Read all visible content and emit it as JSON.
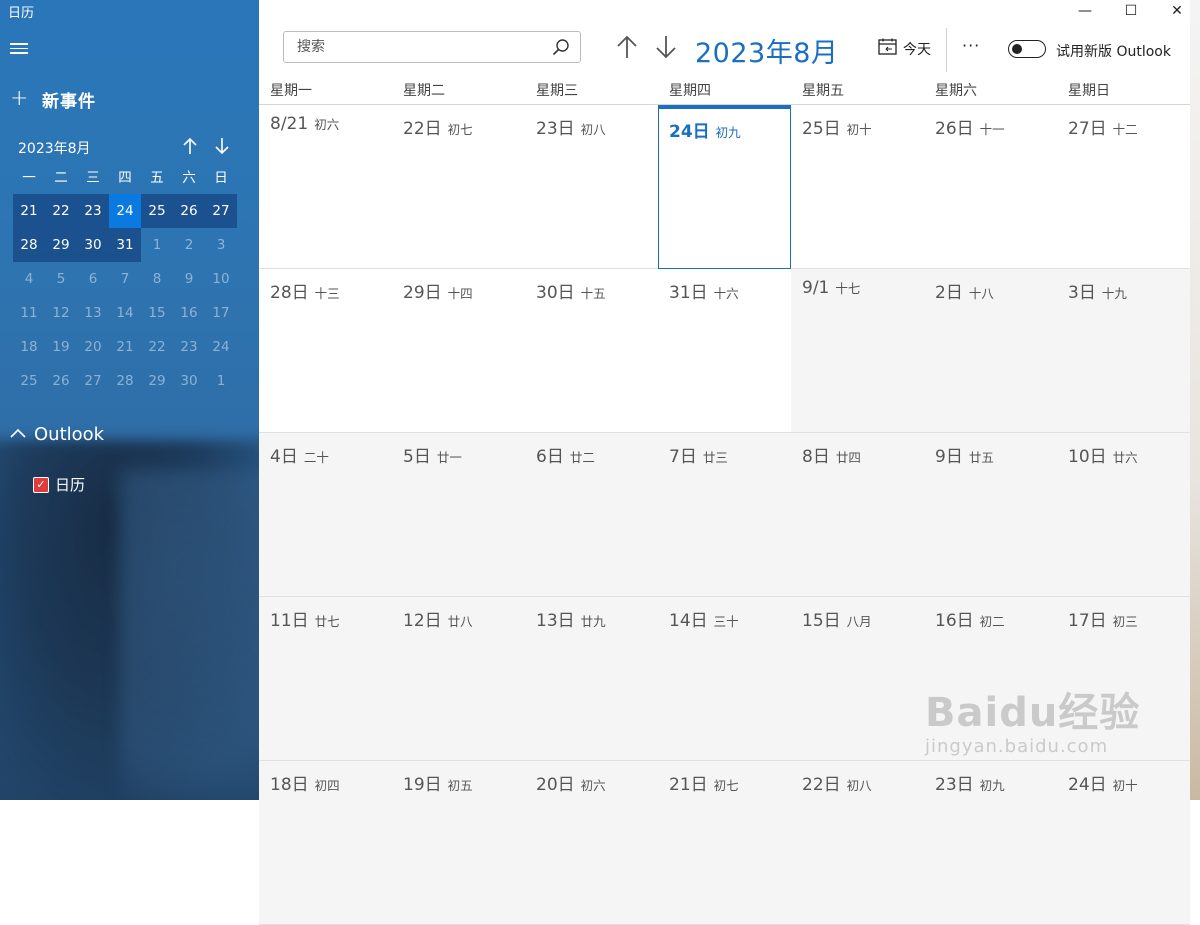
{
  "app": {
    "title": "日历"
  },
  "sidebar": {
    "new_event_label": "新事件",
    "mini_calendar": {
      "title": "2023年8月",
      "weekdays": [
        "一",
        "二",
        "三",
        "四",
        "五",
        "六",
        "日"
      ],
      "weeks": [
        [
          "21",
          "22",
          "23",
          "24",
          "25",
          "26",
          "27"
        ],
        [
          "28",
          "29",
          "30",
          "31",
          "1",
          "2",
          "3"
        ],
        [
          "4",
          "5",
          "6",
          "7",
          "8",
          "9",
          "10"
        ],
        [
          "11",
          "12",
          "13",
          "14",
          "15",
          "16",
          "17"
        ],
        [
          "18",
          "19",
          "20",
          "21",
          "22",
          "23",
          "24"
        ],
        [
          "25",
          "26",
          "27",
          "28",
          "29",
          "30",
          "1"
        ]
      ],
      "today": "24"
    },
    "account": {
      "name": "Outlook",
      "calendars": [
        {
          "name": "日历",
          "checked": true,
          "color": "#e03c3c"
        }
      ]
    }
  },
  "toolbar": {
    "search_placeholder": "搜索",
    "month_title": "2023年8月",
    "today_label": "今天",
    "more_label": "···",
    "toggle_label": "试用新版 Outlook",
    "toggle_on": false
  },
  "window_controls": {
    "minimize": "—",
    "maximize": "☐",
    "close": "✕"
  },
  "calendar": {
    "weekdays": [
      "星期一",
      "星期二",
      "星期三",
      "星期四",
      "星期五",
      "星期六",
      "星期日"
    ],
    "weeks": [
      [
        {
          "d": "8/21",
          "l": "初六",
          "cur": true
        },
        {
          "d": "22日",
          "l": "初七",
          "cur": true
        },
        {
          "d": "23日",
          "l": "初八",
          "cur": true
        },
        {
          "d": "24日",
          "l": "初九",
          "cur": true,
          "today": true
        },
        {
          "d": "25日",
          "l": "初十",
          "cur": true
        },
        {
          "d": "26日",
          "l": "十一",
          "cur": true
        },
        {
          "d": "27日",
          "l": "十二",
          "cur": true
        }
      ],
      [
        {
          "d": "28日",
          "l": "十三",
          "cur": true
        },
        {
          "d": "29日",
          "l": "十四",
          "cur": true
        },
        {
          "d": "30日",
          "l": "十五",
          "cur": true
        },
        {
          "d": "31日",
          "l": "十六",
          "cur": true
        },
        {
          "d": "9/1",
          "l": "十七",
          "cur": false
        },
        {
          "d": "2日",
          "l": "十八",
          "cur": false
        },
        {
          "d": "3日",
          "l": "十九",
          "cur": false
        }
      ],
      [
        {
          "d": "4日",
          "l": "二十",
          "cur": false
        },
        {
          "d": "5日",
          "l": "廿一",
          "cur": false
        },
        {
          "d": "6日",
          "l": "廿二",
          "cur": false
        },
        {
          "d": "7日",
          "l": "廿三",
          "cur": false
        },
        {
          "d": "8日",
          "l": "廿四",
          "cur": false
        },
        {
          "d": "9日",
          "l": "廿五",
          "cur": false
        },
        {
          "d": "10日",
          "l": "廿六",
          "cur": false
        }
      ],
      [
        {
          "d": "11日",
          "l": "廿七",
          "cur": false
        },
        {
          "d": "12日",
          "l": "廿八",
          "cur": false
        },
        {
          "d": "13日",
          "l": "廿九",
          "cur": false
        },
        {
          "d": "14日",
          "l": "三十",
          "cur": false
        },
        {
          "d": "15日",
          "l": "八月",
          "cur": false
        },
        {
          "d": "16日",
          "l": "初二",
          "cur": false
        },
        {
          "d": "17日",
          "l": "初三",
          "cur": false
        }
      ],
      [
        {
          "d": "18日",
          "l": "初四",
          "cur": false
        },
        {
          "d": "19日",
          "l": "初五",
          "cur": false
        },
        {
          "d": "20日",
          "l": "初六",
          "cur": false
        },
        {
          "d": "21日",
          "l": "初七",
          "cur": false
        },
        {
          "d": "22日",
          "l": "初八",
          "cur": false
        },
        {
          "d": "23日",
          "l": "初九",
          "cur": false
        },
        {
          "d": "24日",
          "l": "初十",
          "cur": false
        }
      ]
    ]
  },
  "colors": {
    "accent": "#1a6fc0",
    "today_mini": "#0a7ae0",
    "sidebar": "#2a76b9"
  },
  "watermark": {
    "brand": "Baidu经验",
    "url": "jingyan.baidu.com"
  }
}
